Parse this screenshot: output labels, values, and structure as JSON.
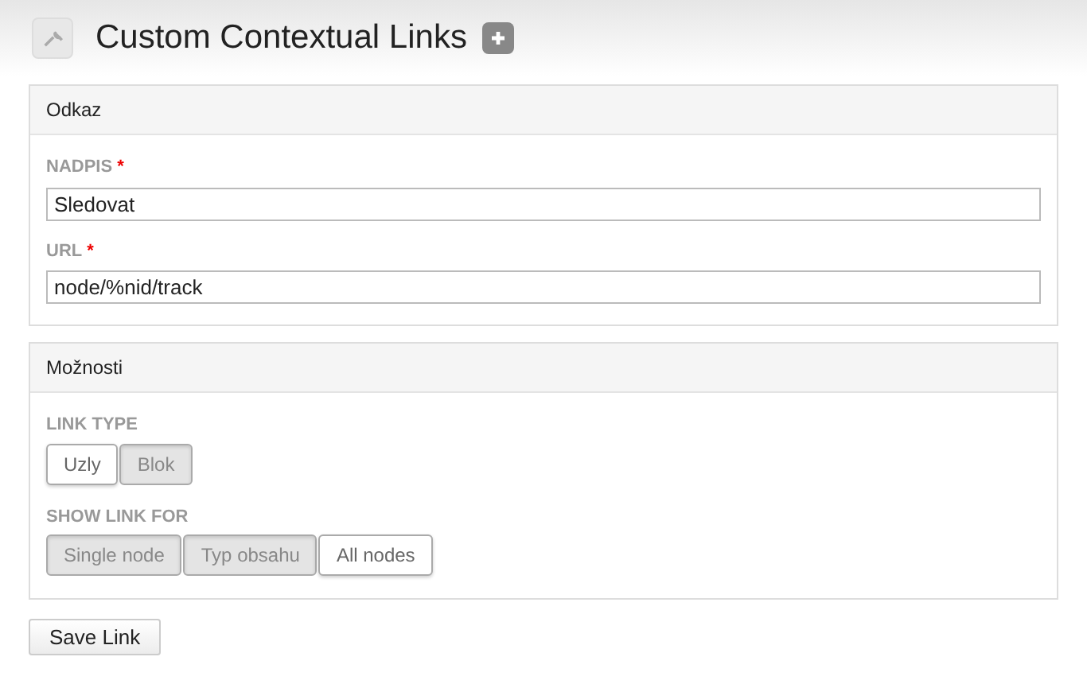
{
  "page": {
    "title": "Custom Contextual Links"
  },
  "panels": [
    {
      "title": "Odkaz",
      "fields": [
        {
          "kind": "text",
          "label": "NADPIS",
          "required_mark": "*",
          "value": "Sledovat"
        },
        {
          "kind": "text",
          "label": "URL",
          "required_mark": "*",
          "value": "node/%nid/track"
        }
      ]
    },
    {
      "title": "Možnosti",
      "fields": [
        {
          "kind": "toggle",
          "label": "LINK TYPE",
          "options": [
            {
              "label": "Uzly",
              "selected": true
            },
            {
              "label": "Blok",
              "selected": false
            }
          ]
        },
        {
          "kind": "toggle",
          "label": "SHOW LINK FOR",
          "options": [
            {
              "label": "Single node",
              "selected": false
            },
            {
              "label": "Typ obsahu",
              "selected": false
            },
            {
              "label": "All nodes",
              "selected": true
            }
          ]
        }
      ]
    }
  ],
  "submit": "Save Link"
}
